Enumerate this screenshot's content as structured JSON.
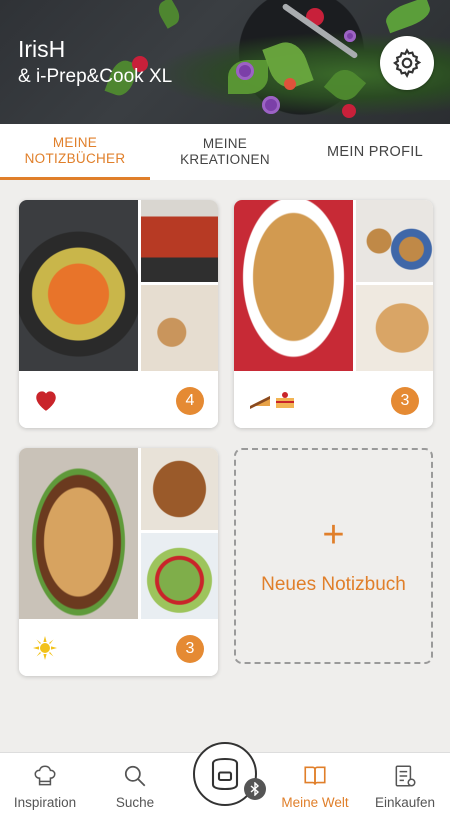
{
  "header": {
    "user_name": "IrisH",
    "device_name": "& i-Prep&Cook XL"
  },
  "tabs": [
    {
      "label": "MEINE\nNOTIZBÜCHER",
      "active": true
    },
    {
      "label": "MEINE\nKREATIONEN",
      "active": false
    },
    {
      "label": "MEIN PROFIL",
      "active": false
    }
  ],
  "notebooks": [
    {
      "tag_icon": "heart-icon",
      "count": "4"
    },
    {
      "tag_icon": "cake-icon",
      "count": "3"
    },
    {
      "tag_icon": "sun-icon",
      "count": "3"
    }
  ],
  "new_notebook": {
    "plus": "+",
    "label": "Neues Notizbuch"
  },
  "bottom_nav": [
    {
      "label": "Inspiration",
      "icon": "chef-hat-icon",
      "active": false
    },
    {
      "label": "Suche",
      "icon": "search-icon",
      "active": false
    },
    {
      "label": "Meine Welt",
      "icon": "book-icon",
      "active": true
    },
    {
      "label": "Einkaufen",
      "icon": "shopping-list-icon",
      "active": false
    }
  ],
  "center_button": {
    "icon": "cooker-icon",
    "badge_icon": "bluetooth-icon"
  },
  "colors": {
    "accent": "#e07f2a",
    "badge": "#e58a33",
    "background": "#efeeec"
  }
}
